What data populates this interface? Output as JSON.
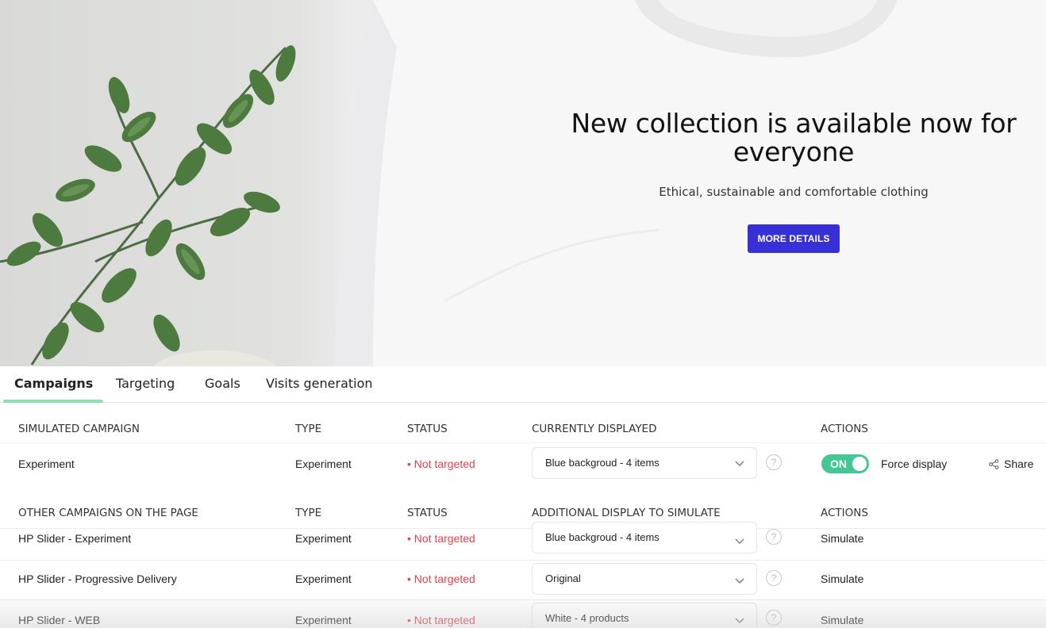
{
  "hero": {
    "title": "New collection is available now for everyone",
    "subtitle": "Ethical, sustainable and comfortable clothing",
    "cta_label": "MORE DETAILS"
  },
  "tabs": [
    {
      "label": "Campaigns",
      "active": true
    },
    {
      "label": "Targeting",
      "active": false
    },
    {
      "label": "Goals",
      "active": false
    },
    {
      "label": "Visits generation",
      "active": false
    }
  ],
  "simulated": {
    "headers": {
      "name": "SIMULATED CAMPAIGN",
      "type": "TYPE",
      "status": "STATUS",
      "display": "CURRENTLY DISPLAYED",
      "actions": "ACTIONS"
    },
    "row": {
      "name": "Experiment",
      "type": "Experiment",
      "status": "Not targeted",
      "display": "Blue backgroud - 4 items",
      "toggle": "ON",
      "force_label": "Force display",
      "share_label": "Share"
    }
  },
  "others": {
    "headers": {
      "name": "OTHER CAMPAIGNS ON THE PAGE",
      "type": "TYPE",
      "status": "STATUS",
      "display": "ADDITIONAL DISPLAY TO SIMULATE",
      "actions": "ACTIONS"
    },
    "rows": [
      {
        "name": "HP Slider - Experiment",
        "type": "Experiment",
        "status": "Not targeted",
        "display": "Blue backgroud - 4 items",
        "action": "Simulate"
      },
      {
        "name": "HP Slider - Progressive Delivery",
        "type": "Experiment",
        "status": "Not targeted",
        "display": "Original",
        "action": "Simulate"
      },
      {
        "name": "HP Slider - WEB",
        "type": "Experiment",
        "status": "Not targeted",
        "display": "White - 4 products",
        "action": "Simulate"
      }
    ]
  },
  "colors": {
    "cta": "#3730d6",
    "tab_underline": "#8fdcb5",
    "status_red": "#e0414d",
    "toggle_green": "#43c793"
  },
  "icons": {
    "help": "?",
    "chevron": "chevron-down-icon",
    "share": "share-icon"
  }
}
